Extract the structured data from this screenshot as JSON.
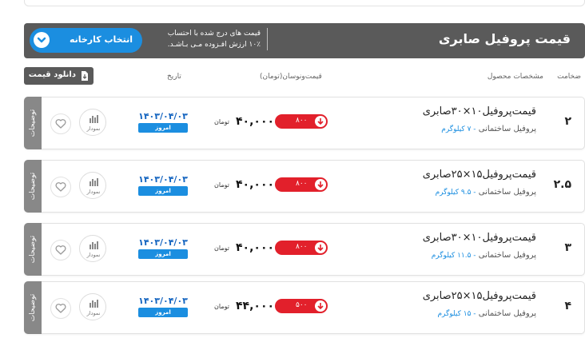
{
  "header": {
    "title": "قیمت پروفیل صابری",
    "vat_note_line1": "قیمت های درج شده با احتساب",
    "vat_note_line2": "۱۰٪ ارزش افـزوده مـی بـاشـد.",
    "factory_button": "انتخاب کارخانه"
  },
  "download_button": "دانلود قیمت",
  "columns": {
    "thickness": "ضخامت",
    "spec": "مشخصات محصول",
    "price": "قیمت‌ونوسان(تومان)",
    "date": "تاریخ"
  },
  "rows": [
    {
      "thickness": "۲",
      "name": "قیمت‌پروفیل۱۰×۳۰صابری",
      "type": "پروفیل ساختمانی",
      "weight": "- ۷ کیلوگرم",
      "change": "۸۰۰",
      "price": "۴۰,۰۰۰",
      "unit": "تومان",
      "date": "۱۴۰۳/۰۴/۰۳",
      "today": "امروز",
      "chart_label": "نمودار",
      "desc": "توضیحات"
    },
    {
      "thickness": "۲.۵",
      "name": "قیمت‌پروفیل۱۵×۲۵صابری",
      "type": "پروفیل ساختمانی",
      "weight": "- ۹.۵ کیلوگرم",
      "change": "۸۰۰",
      "price": "۴۰,۰۰۰",
      "unit": "تومان",
      "date": "۱۴۰۳/۰۴/۰۳",
      "today": "امروز",
      "chart_label": "نمودار",
      "desc": "توضیحات"
    },
    {
      "thickness": "۳",
      "name": "قیمت‌پروفیل۱۰×۳۰صابری",
      "type": "پروفیل ساختمانی",
      "weight": "- ۱۱.۵ کیلوگرم",
      "change": "۸۰۰",
      "price": "۴۰,۰۰۰",
      "unit": "تومان",
      "date": "۱۴۰۳/۰۴/۰۳",
      "today": "امروز",
      "chart_label": "نمودار",
      "desc": "توضیحات"
    },
    {
      "thickness": "۴",
      "name": "قیمت‌پروفیل۱۵×۲۵صابری",
      "type": "پروفیل ساختمانی",
      "weight": "- ۱۵ کیلوگرم",
      "change": "۵۰۰",
      "price": "۴۴,۰۰۰",
      "unit": "تومان",
      "date": "۱۴۰۳/۰۴/۰۳",
      "today": "امروز",
      "chart_label": "نمودار",
      "desc": "توضیحات"
    }
  ],
  "colors": {
    "header_bg": "#5a5a5a",
    "accent_blue": "#1b8ee0",
    "change_red": "#e2202b",
    "date_blue": "#1565c0"
  },
  "icons": {
    "factory": "chevron-down-icon",
    "download": "file-download-icon",
    "change": "arrow-down-circle-icon",
    "chart": "bar-chart-icon",
    "favorite": "heart-icon"
  }
}
